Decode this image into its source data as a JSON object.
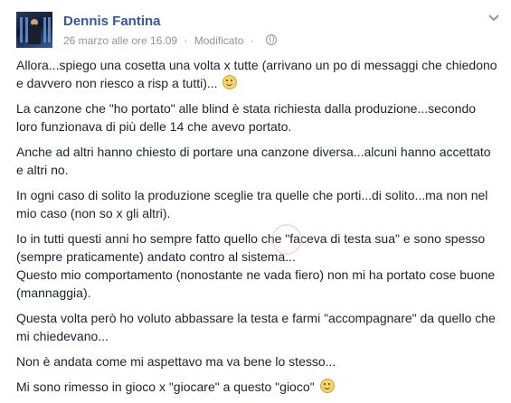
{
  "post": {
    "author": "Dennis Fantina",
    "timestamp": "26 marzo alle ore 16.09",
    "separator": "·",
    "edited_label": "Modificato",
    "privacy_icon": "globe-icon",
    "menu_icon": "chevron-down-icon"
  },
  "paragraphs": [
    "Allora...spiego una cosetta una volta x tutte (arrivano un po di messaggi che chiedono e davvero non riesco a risp a tutti)...",
    "La canzone che \"ho portato\" alle blind è stata richiesta dalla produzione...secondo loro funzionava di più delle 14 che avevo portato.",
    "Anche ad altri hanno chiesto di portare una canzone diversa...alcuni hanno accettato e altri no.",
    "In ogni caso di solito la produzione sceglie tra quelle che porti...di solito...ma non nel mio caso (non so x gli altri).",
    "Io in tutti questi anni ho sempre fatto quello che \"faceva di testa sua\" e sono spesso (sempre praticamente) andato contro al sistema...",
    "Questo mio comportamento (nonostante ne vada fiero) non mi ha portato cose buone (mannaggia).",
    "Questa volta però ho voluto abbassare la testa e farmi \"accompagnare\" da quello che mi chiedevano...",
    "Non è andata come mi aspettavo ma va bene lo stesso...",
    "Mi sono rimesso in gioco x \"giocare\" a questo \"gioco\""
  ]
}
